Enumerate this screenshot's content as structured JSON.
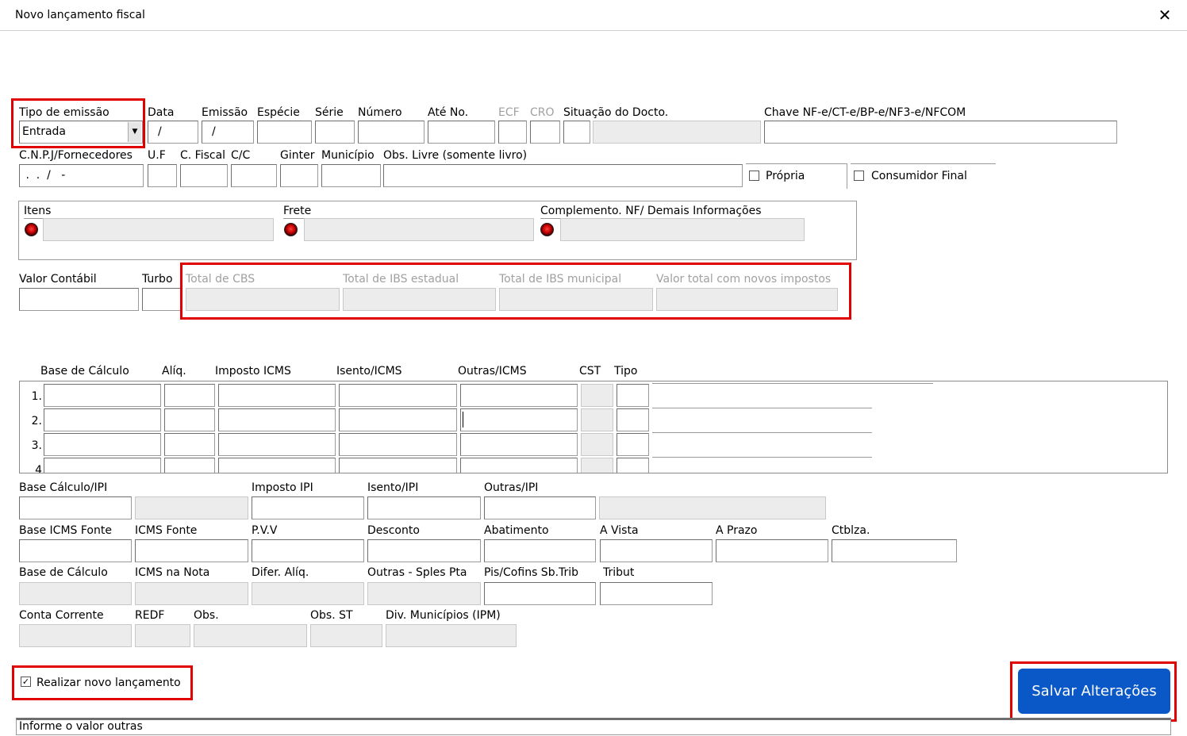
{
  "window": {
    "title": "Novo lançamento fiscal",
    "close_icon": "close-icon"
  },
  "header_row1": {
    "tipo_emissao_label": "Tipo de emissão",
    "tipo_emissao_value": "Entrada",
    "data_label": "Data",
    "data_value": "/",
    "emissao_label": "Emissão",
    "emissao_value": "/",
    "especie_label": "Espécie",
    "serie_label": "Série",
    "numero_label": "Número",
    "ate_no_label": "Até No.",
    "ecf_label": "ECF",
    "cro_label": "CRO",
    "situacao_label": "Situação do Docto.",
    "chave_label": "Chave NF-e/CT-e/BP-e/NF3-e/NFCOM"
  },
  "header_row2": {
    "cnpj_label": "C.N.P.J/Fornecedores",
    "cnpj_value": " .  .  /   -",
    "uf_label": "U.F",
    "cfiscal_label": "C. Fiscal",
    "cc_label": "C/C",
    "ginter_label": "Ginter",
    "municipio_label": "Município",
    "obs_livre_label": "Obs. Livre (somente livro)",
    "propria_label": "Própria",
    "consumidor_final_label": "Consumidor Final"
  },
  "group": {
    "itens_label": "Itens",
    "frete_label": "Frete",
    "complemento_label": "Complemento. NF/ Demais Informações"
  },
  "totals": {
    "valor_contabil_label": "Valor Contábil",
    "turbo_label": "Turbo",
    "cbs_label": "Total de CBS",
    "ibs_estadual_label": "Total de IBS estadual",
    "ibs_municipal_label": "Total de IBS municipal",
    "valor_total_label": "Valor total com novos impostos"
  },
  "table": {
    "headers": [
      "Base de Cálculo",
      "Alíq.",
      "Imposto ICMS",
      "Isento/ICMS",
      "Outras/ICMS",
      "CST",
      "Tipo"
    ],
    "row_numbers": [
      "1.",
      "2.",
      "3.",
      "4"
    ]
  },
  "ipi": {
    "base_label": "Base Cálculo/IPI",
    "imposto_label": "Imposto IPI",
    "isento_label": "Isento/IPI",
    "outras_label": "Outras/IPI"
  },
  "fonte": {
    "base_icms_fonte_label": "Base ICMS Fonte",
    "icms_fonte_label": "ICMS Fonte",
    "pvv_label": "P.V.V",
    "desconto_label": "Desconto",
    "abatimento_label": "Abatimento",
    "a_vista_label": "A Vista",
    "a_prazo_label": "A Prazo",
    "ctblza_label": "Ctblza."
  },
  "nota": {
    "base_calculo_label": "Base de Cálculo",
    "icms_nota_label": "ICMS na Nota",
    "difer_aliq_label": "Difer. Alíq.",
    "outras_spl_label": "Outras - Sples Pta",
    "pis_cofins_label": "Pis/Cofins Sb.Trib",
    "tribut_label": "Tribut"
  },
  "conta": {
    "conta_corrente_label": "Conta Corrente",
    "redf_label": "REDF",
    "obs_label": "Obs.",
    "obs_st_label": "Obs. ST",
    "div_municipios_label": "Div. Municípios (IPM)"
  },
  "footer": {
    "realizar_novo_label": "Realizar novo lançamento",
    "realizar_checked": "✓",
    "save_label": "Salvar Alterações",
    "status_text": "Informe o valor outras"
  },
  "colors": {
    "highlight": "#e00000",
    "save_button": "#0a58c8"
  }
}
